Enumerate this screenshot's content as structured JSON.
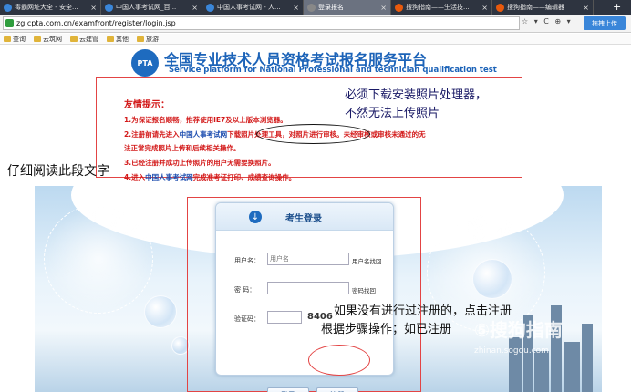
{
  "tabs": [
    {
      "label": "毒霸网址大全 - 安全...",
      "icon_color": "#3a86d9",
      "active": false
    },
    {
      "label": "中国人事考试网_百...",
      "icon_color": "#3a86d9",
      "active": false
    },
    {
      "label": "中国人事考试网 - 人...",
      "icon_color": "#3a86d9",
      "active": false
    },
    {
      "label": "登录报名",
      "icon_color": "#888888",
      "active": true
    },
    {
      "label": "搜狗指南——生活技...",
      "icon_color": "#e8590c",
      "active": false
    },
    {
      "label": "搜狗指南——编辑器",
      "icon_color": "#e8590c",
      "active": false
    }
  ],
  "new_tab_label": "+",
  "address": {
    "url": "zg.cpta.com.cn/examfront/register/login.jsp",
    "nav": "☆ ▾ C ⊕ ▾",
    "right_button": "拖拽上传"
  },
  "bookmarks": [
    "查询",
    "云筑网",
    "云建管",
    "其他",
    "旅游"
  ],
  "header": {
    "logo": "PTA",
    "title": "全国专业技术人员资格考试报名服务平台",
    "subtitle": "Service platform for National Professional and technician qualification test"
  },
  "notice": {
    "title": "友情提示：",
    "lines": [
      {
        "pre": "1.为保证报名顺畅，推荐使用IE7及以上版本浏览器。",
        "blue": "",
        "post": ""
      },
      {
        "pre": "2.注册前请先进入",
        "blue": "中国人事考试网",
        "post": "下载照片处理工具，对照片进行审核。未经审核或审核未通过的无"
      },
      {
        "pre": "法正常完成照片上传和后续相关操作。",
        "blue": "",
        "post": ""
      },
      {
        "pre": "3.已经注册并成功上传照片的用户无需要换照片。",
        "blue": "",
        "post": ""
      },
      {
        "pre": "4.进入",
        "blue": "中国人事考试网",
        "post": "完成准考证打印、成绩查询操作。"
      }
    ]
  },
  "annotations": {
    "top_1": "必须下载安装照片处理器，",
    "top_2": "不然无法上传照片",
    "side": "仔细阅读此段文字",
    "bottom_1": "如果没有进行过注册的，点击注册",
    "bottom_2": "根据步骤操作；如已注册"
  },
  "login": {
    "title": "考生登录",
    "username_label": "用户名：",
    "username_placeholder": "用户名",
    "username_link": "用户名找回",
    "password_label": "密  码：",
    "password_link": "密码找回",
    "captcha_label": "验证码：",
    "captcha_value": "8406",
    "login_button": "登录",
    "register_button": "注册"
  },
  "watermark": {
    "line1": "⑤搜狗指南",
    "line2": "zhinan.sogou.com"
  }
}
